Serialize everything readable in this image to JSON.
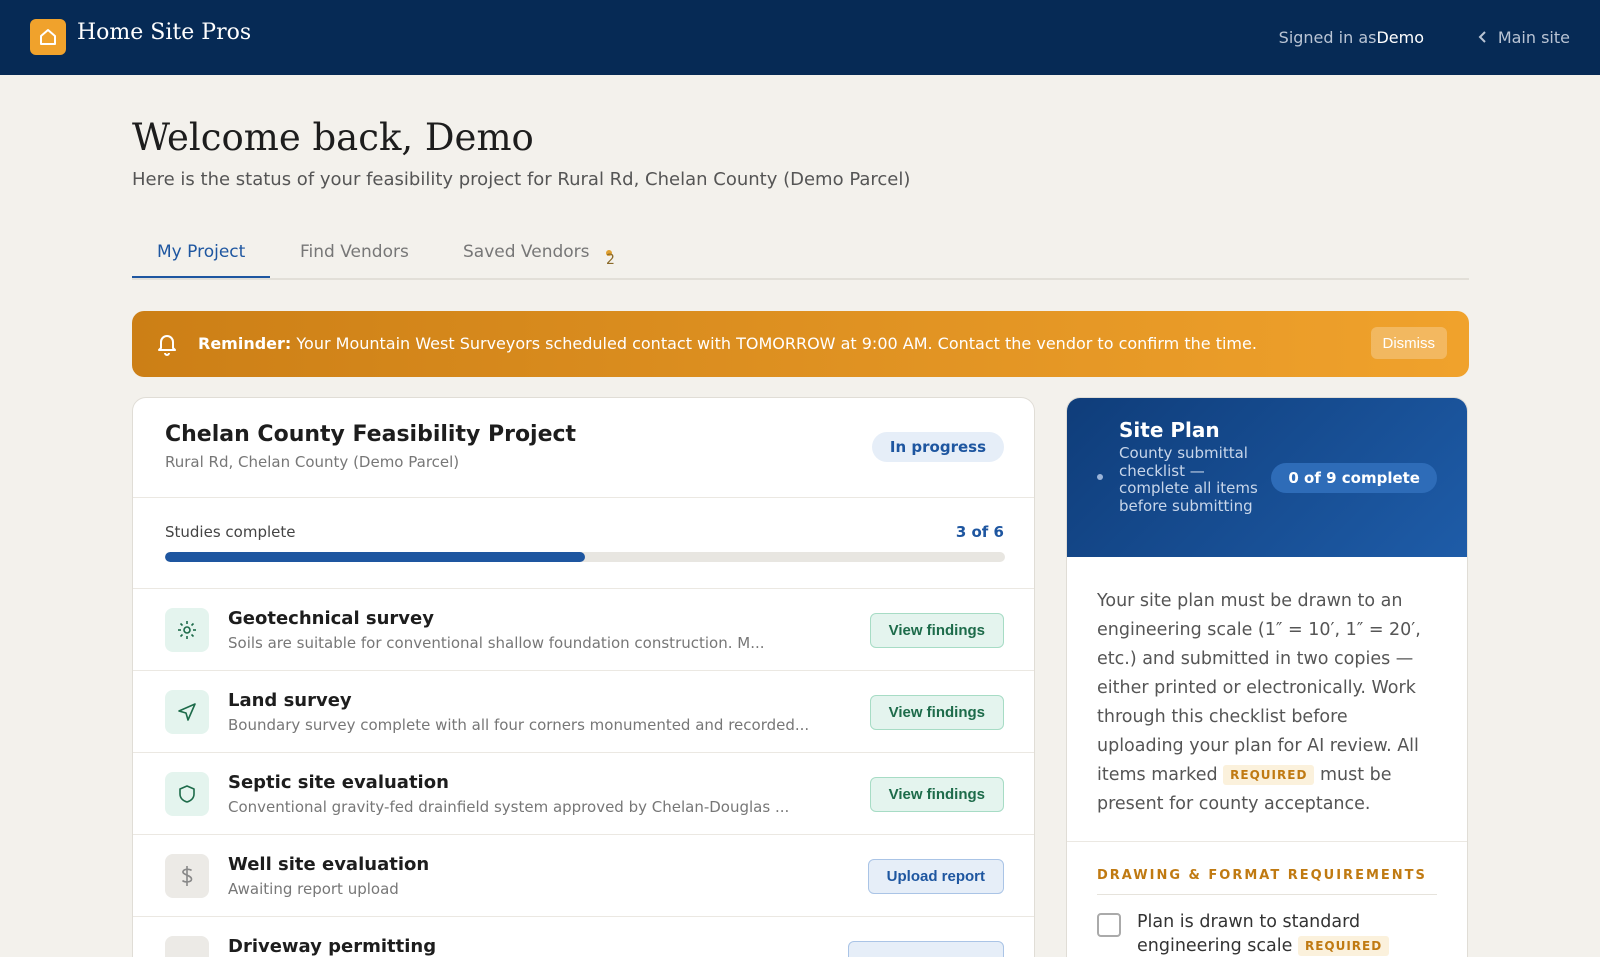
{
  "app": {
    "brand": "Home Site Pros",
    "signed_in_prefix": "Signed in as",
    "user": "Demo",
    "main_site_link": "Main site"
  },
  "header": {
    "welcome": "Welcome back, Demo",
    "subtitle": "Here is the status of your feasibility project for Rural Rd, Chelan County (Demo Parcel)"
  },
  "tabs": [
    {
      "label": "My Project",
      "active": true
    },
    {
      "label": "Find Vendors",
      "active": false
    },
    {
      "label": "Saved Vendors",
      "active": false,
      "badge": "2"
    }
  ],
  "reminder": {
    "label": "Reminder:",
    "text": "Your Mountain West Surveyors scheduled contact with TOMORROW at 9:00 AM. Contact the vendor to confirm the time.",
    "dismiss_label": "Dismiss"
  },
  "project": {
    "title": "Chelan County Feasibility Project",
    "address": "Rural Rd, Chelan County (Demo Parcel)",
    "status": "In progress",
    "studies_label": "Studies complete",
    "studies_count": "3 of 6",
    "studies_fraction": 0.5,
    "studies": [
      {
        "name": "Geotechnical survey",
        "desc": "Soils are suitable for conventional shallow foundation construction. M...",
        "action": "View findings",
        "icon": "sun-icon",
        "state": "complete"
      },
      {
        "name": "Land survey",
        "desc": "Boundary survey complete with all four corners monumented and recorded...",
        "action": "View findings",
        "icon": "navigation-arrow-icon",
        "state": "complete"
      },
      {
        "name": "Septic site evaluation",
        "desc": "Conventional gravity-fed drainfield system approved by Chelan-Douglas ...",
        "action": "View findings",
        "icon": "shield-icon",
        "state": "complete"
      },
      {
        "name": "Well site evaluation",
        "desc": "Awaiting report upload",
        "action": "Upload report",
        "icon": "dollar-icon",
        "state": "pending"
      },
      {
        "name": "Driveway permitting",
        "desc": "",
        "action": "",
        "icon": "",
        "state": "pending"
      }
    ]
  },
  "site_plan": {
    "title": "Site Plan",
    "subtitle": "County submittal checklist — complete all items before submitting",
    "progress": "0 of 9 complete",
    "body_before": "Your site plan must be drawn to an engineering scale (1″ = 10′, 1″ = 20′, etc.) and submitted in two copies — either printed or electronically. Work through this checklist before uploading your plan for AI review. All items marked",
    "required_tag": "REQUIRED",
    "body_after": "must be present for county acceptance.",
    "section_title": "DRAWING & FORMAT REQUIREMENTS",
    "checklist": [
      {
        "label": "Plan is drawn to standard engineering scale",
        "tag": "REQUIRED",
        "checked": false
      }
    ]
  },
  "colors": {
    "topbar": "#062a55",
    "accent_blue": "#1e56a0",
    "brand_orange": "#f0a22c",
    "success_green": "#1d6b4a"
  }
}
